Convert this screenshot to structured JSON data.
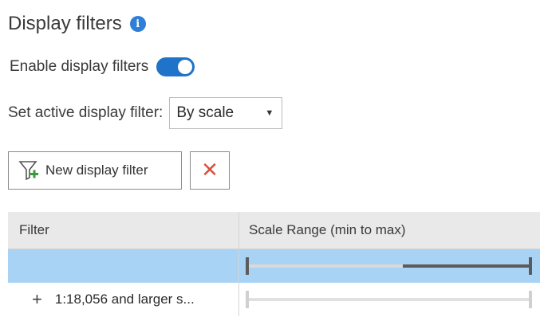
{
  "header": {
    "title": "Display filters",
    "info_icon": "info-icon"
  },
  "enable": {
    "label": "Enable display filters",
    "enabled": true,
    "accent": "#1f73c8"
  },
  "active_filter": {
    "label": "Set active display filter:",
    "value": "By scale"
  },
  "toolbar": {
    "new_label": "New display filter",
    "delete_icon": "close-icon",
    "delete_color": "#d9533c"
  },
  "table": {
    "columns": [
      "Filter",
      "Scale Range (min to max)"
    ],
    "rows": [
      {
        "label": "",
        "selected": true,
        "range_fill": [
          0.55,
          1.0
        ]
      },
      {
        "label": "1:18,056 and larger s...",
        "selected": false,
        "range_fill": [
          0,
          0
        ]
      }
    ],
    "selected_color": "#a9d3f5"
  }
}
